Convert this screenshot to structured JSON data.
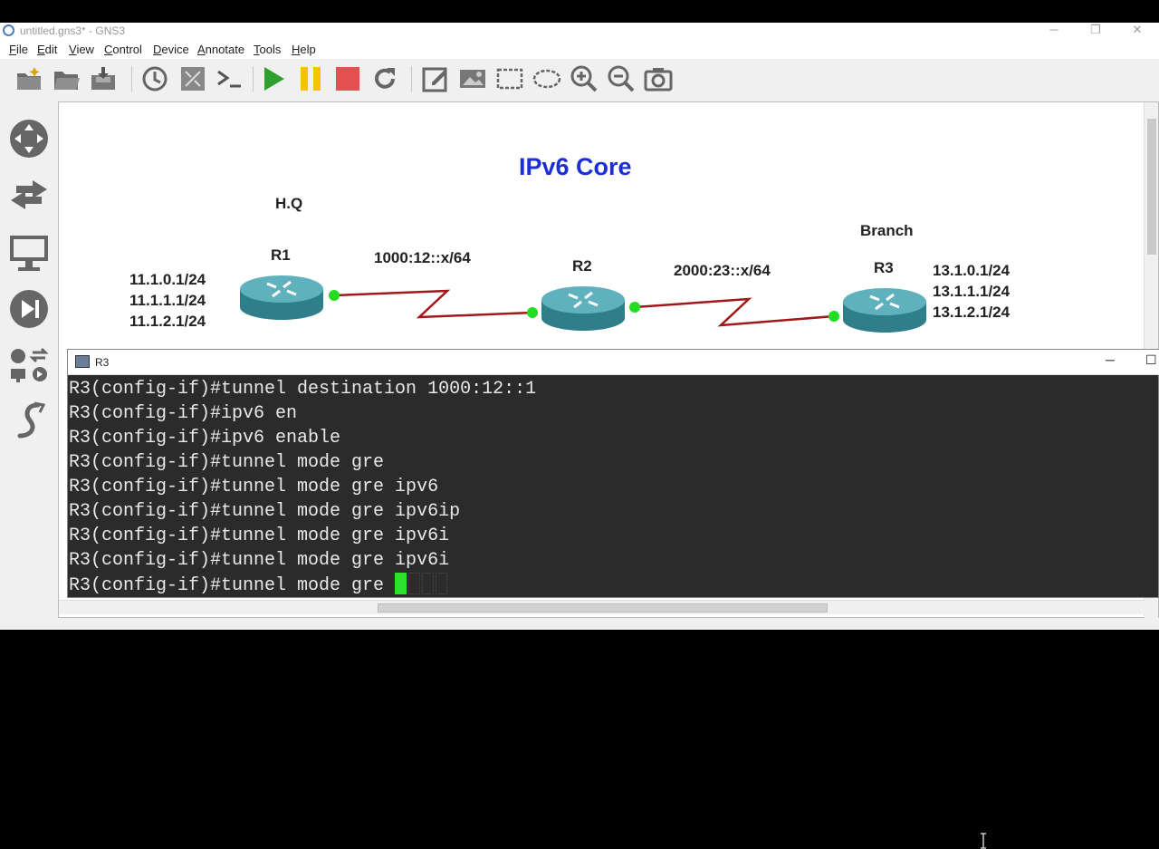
{
  "window": {
    "title": "untitled.gns3* - GNS3",
    "controls": [
      "─",
      "❐",
      "✕"
    ]
  },
  "menu": [
    "File",
    "Edit",
    "View",
    "Control",
    "Device",
    "Annotate",
    "Tools",
    "Help"
  ],
  "toolbar": [
    "new-project-icon",
    "open-project-icon",
    "save-project-icon",
    "snapshot-icon",
    "show-hide-interfaces-icon",
    "console-all-icon",
    "start-all-icon",
    "suspend-all-icon",
    "stop-all-icon",
    "reload-all-icon",
    "add-note-icon",
    "insert-picture-icon",
    "draw-rectangle-icon",
    "draw-ellipse-icon",
    "zoom-in-icon",
    "zoom-out-icon",
    "screenshot-icon"
  ],
  "leftdock": [
    "browse-all-devices-icon",
    "browse-switches-icon",
    "browse-end-devices-icon",
    "browse-security-devices-icon",
    "browse-all-icon",
    "add-link-icon"
  ],
  "topology": {
    "title": "IPv6 Core",
    "hq_label": "H.Q",
    "branch_label": "Branch",
    "routers": [
      {
        "name": "R1"
      },
      {
        "name": "R2"
      },
      {
        "name": "R3"
      }
    ],
    "links": [
      "1000:12::x/64",
      "2000:23::x/64"
    ],
    "r1_networks": [
      "11.1.0.1/24",
      "11.1.1.1/24",
      "11.1.2.1/24"
    ],
    "r3_networks": [
      "13.1.0.1/24",
      "13.1.1.1/24",
      "13.1.2.1/24"
    ],
    "title_color": "#1c2fd4",
    "link_color": "#a01818",
    "port_color": "#22dd22"
  },
  "terminal": {
    "title": "R3",
    "lines": [
      "R3(config-if)#tunnel destination 1000:12::1",
      "R3(config-if)#ipv6 en",
      "R3(config-if)#ipv6 enable",
      "R3(config-if)#tunnel mode gre",
      "R3(config-if)#tunnel mode gre ipv6",
      "R3(config-if)#tunnel mode gre ipv6ip",
      "R3(config-if)#tunnel mode gre ipv6i",
      "R3(config-if)#tunnel mode gre ipv6i"
    ],
    "prompt_line": "R3(config-if)#tunnel mode gre "
  }
}
